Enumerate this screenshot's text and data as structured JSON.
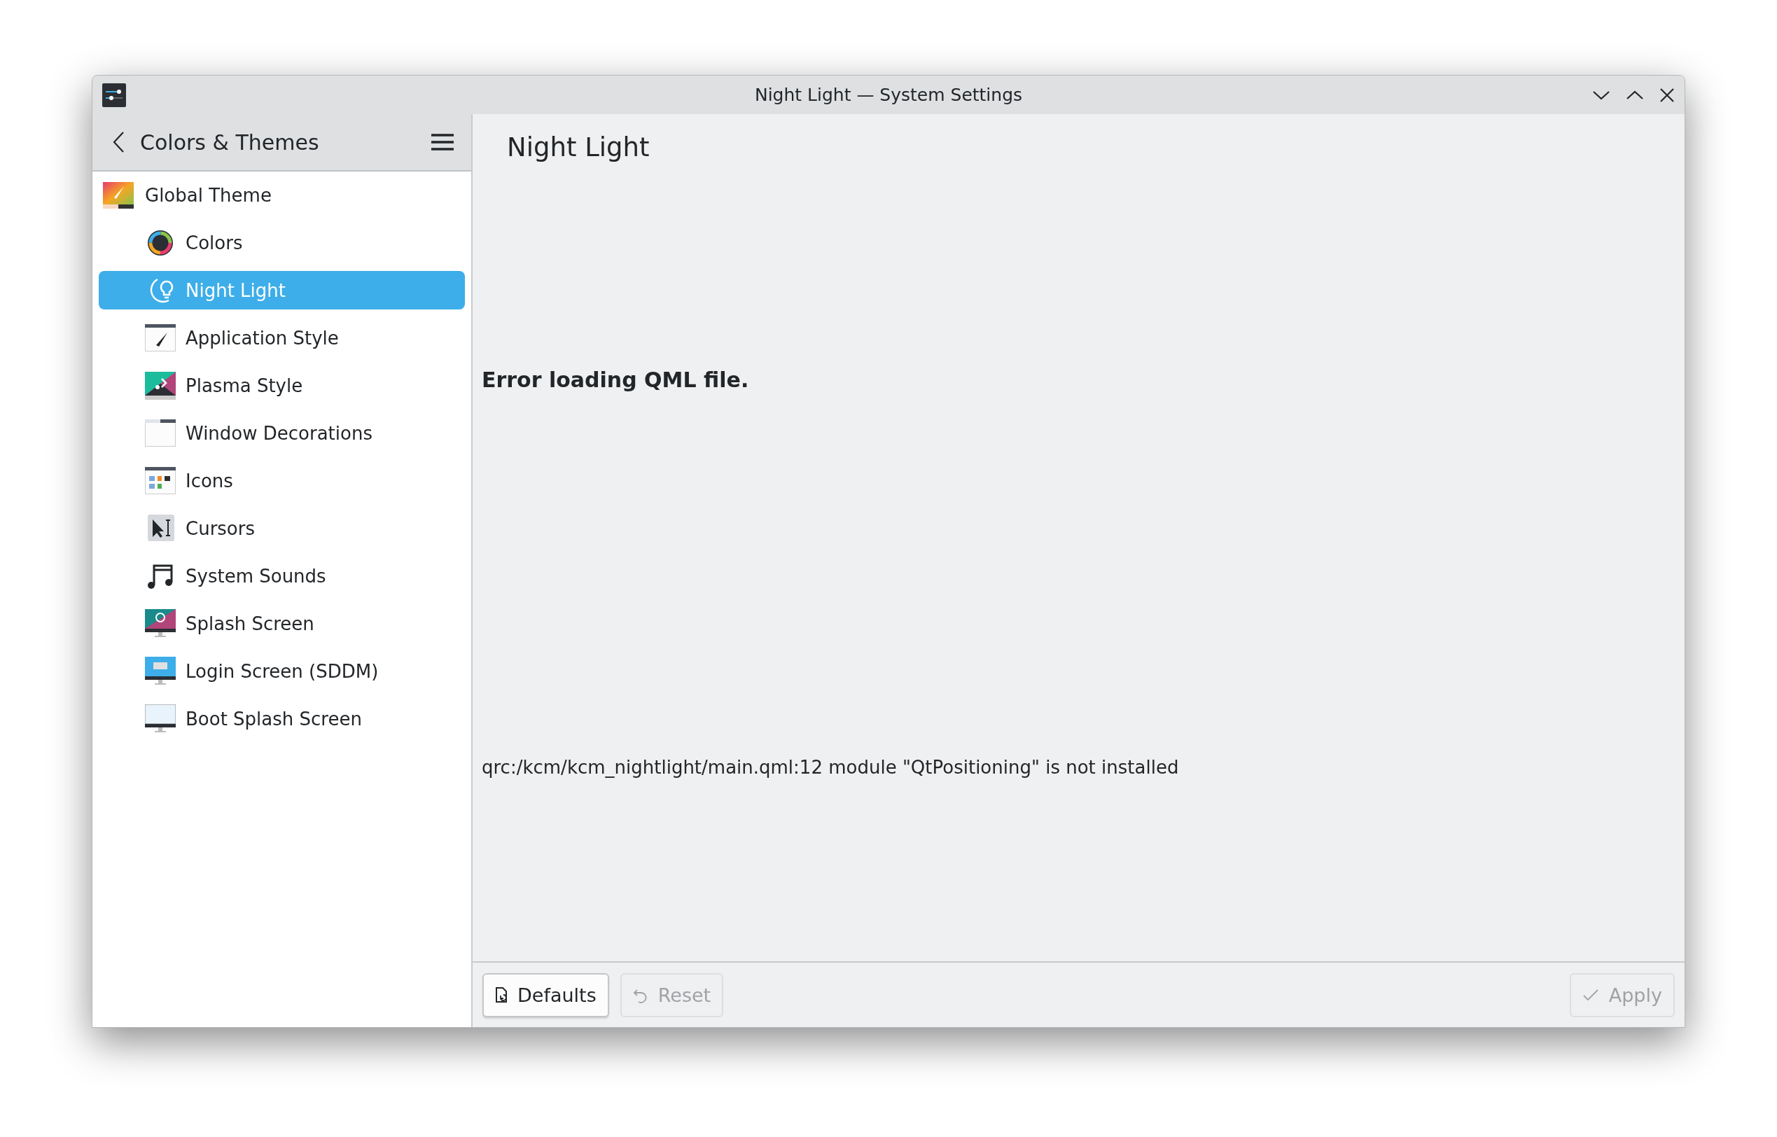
{
  "window": {
    "title": "Night Light — System Settings"
  },
  "sidebar": {
    "header": "Colors & Themes",
    "items": [
      {
        "label": "Global Theme",
        "selected": false,
        "children": [
          {
            "label": "Colors",
            "selected": false
          },
          {
            "label": "Night Light",
            "selected": true
          },
          {
            "label": "Application Style",
            "selected": false
          },
          {
            "label": "Plasma Style",
            "selected": false
          },
          {
            "label": "Window Decorations",
            "selected": false
          },
          {
            "label": "Icons",
            "selected": false
          },
          {
            "label": "Cursors",
            "selected": false
          },
          {
            "label": "System Sounds",
            "selected": false
          },
          {
            "label": "Splash Screen",
            "selected": false
          },
          {
            "label": "Login Screen (SDDM)",
            "selected": false
          },
          {
            "label": "Boot Splash Screen",
            "selected": false
          }
        ]
      }
    ]
  },
  "page": {
    "title": "Night Light",
    "error_heading": "Error loading QML file.",
    "error_detail": "qrc:/kcm/kcm_nightlight/main.qml:12 module \"QtPositioning\" is not installed"
  },
  "footer": {
    "buttons": [
      {
        "label": "Defaults",
        "disabled": false
      },
      {
        "label": "Reset",
        "disabled": true
      },
      {
        "label": "Apply",
        "disabled": true
      }
    ]
  }
}
